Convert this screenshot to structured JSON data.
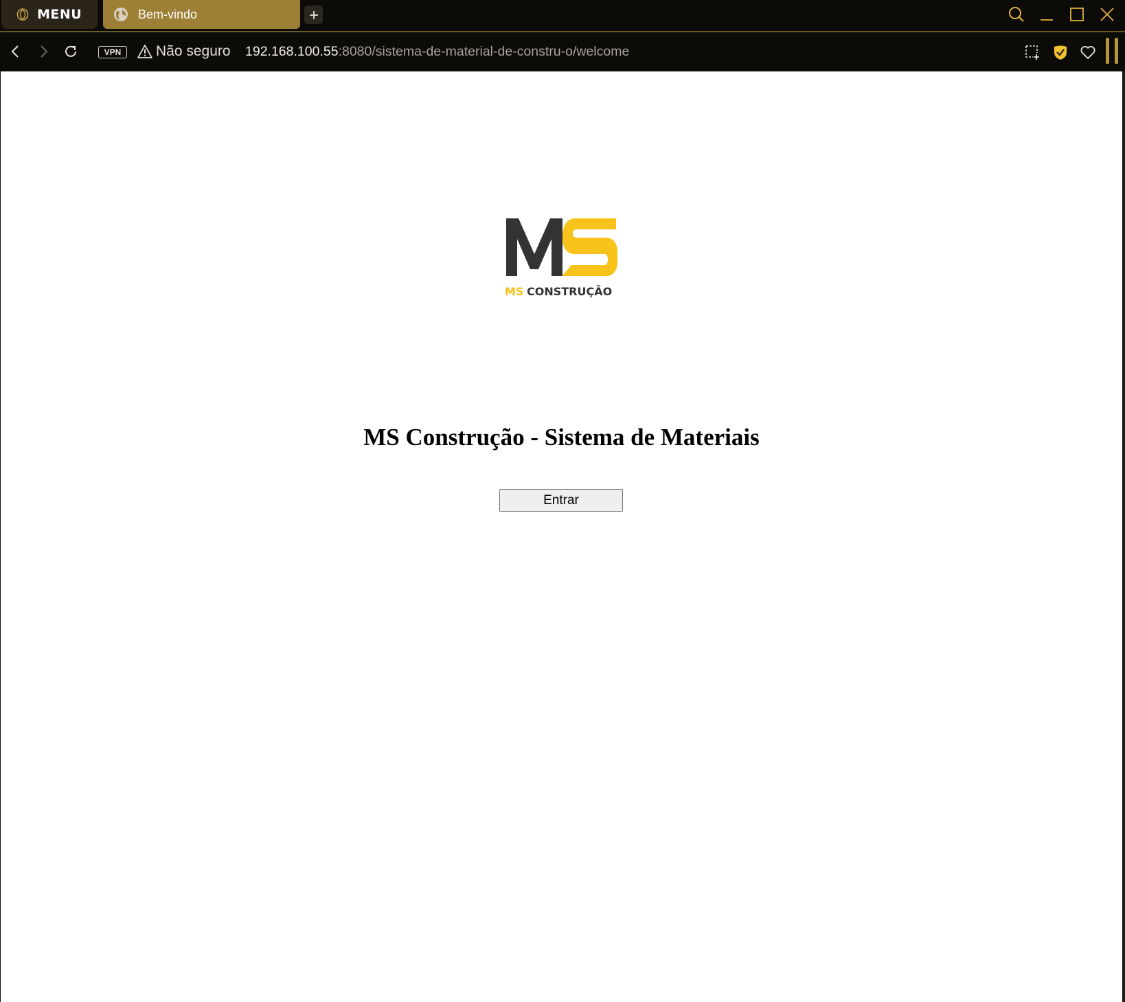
{
  "browser": {
    "menu_label": "MENU",
    "tab_title": "Bem-vindo",
    "security_label": "Não seguro",
    "vpn_label": "VPN",
    "url_host": "192.168.100.55",
    "url_rest": ":8080/sistema-de-material-de-constru-o/welcome",
    "accent_color": "#9d8035",
    "icons": [
      "opera-icon",
      "globe-icon",
      "plus-icon",
      "search-icon",
      "minimize-icon",
      "maximize-icon",
      "close-icon",
      "back-icon",
      "forward-icon",
      "reload-icon",
      "warning-icon",
      "snapshot-icon",
      "shield-icon",
      "heart-icon"
    ]
  },
  "page": {
    "logo": {
      "monogram": "MS",
      "caption_accent": "MS",
      "caption_rest": "CONSTRUÇÃO",
      "dark_color": "#333333",
      "yellow_color": "#f7c31a"
    },
    "title": "MS Construção - Sistema de Materiais",
    "enter_button": "Entrar"
  }
}
